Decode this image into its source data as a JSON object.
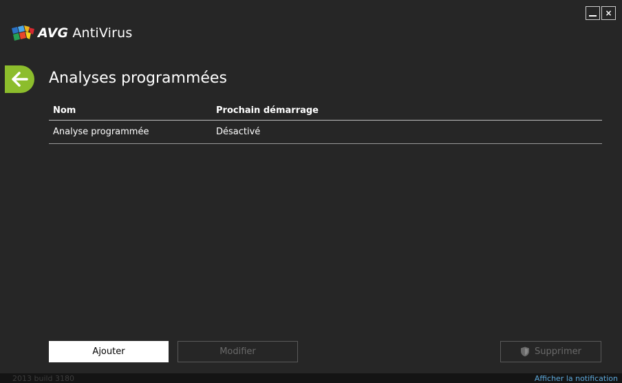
{
  "app": {
    "brand": "AVG",
    "product": "AntiVirus"
  },
  "window_controls": {
    "minimize_icon": "minimize-icon",
    "close_label": "×"
  },
  "page": {
    "title": "Analyses programmées",
    "back_icon": "back-arrow-icon"
  },
  "table": {
    "columns": [
      "Nom",
      "Prochain démarrage"
    ],
    "rows": [
      {
        "name": "Analyse programmée",
        "next_start": "Désactivé"
      }
    ]
  },
  "buttons": {
    "add": "Ajouter",
    "modify": "Modifier",
    "delete": "Supprimer",
    "delete_icon": "shield-icon"
  },
  "statusbar": {
    "build": "2013  build 3180",
    "notification_link": "Afficher la notification"
  },
  "colors": {
    "background": "#262626",
    "accent_green": "#8cbd2c",
    "link_blue": "#5ca7d9"
  }
}
